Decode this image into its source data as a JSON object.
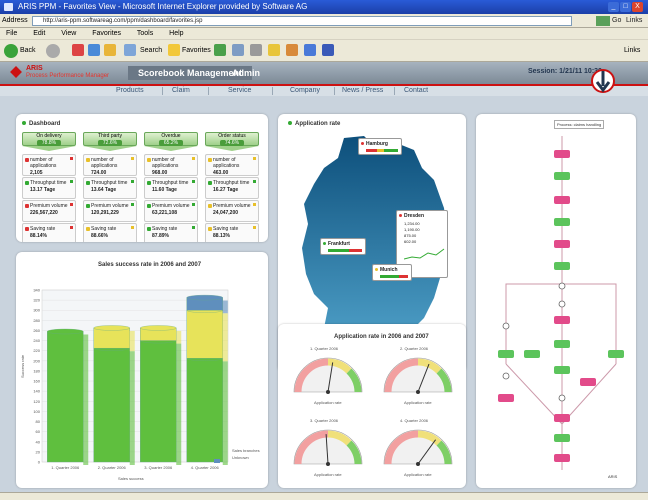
{
  "window": {
    "title": "ARIS PPM - Favorites View - Microsoft Internet Explorer provided by Software AG",
    "controls": [
      "_",
      "□",
      "X"
    ]
  },
  "address_bar": {
    "label": "Address",
    "url": "http://aris-ppm.softwareag.com/ppm/dashboard/favorites.jsp",
    "go_label": "Go",
    "links_label": "Links"
  },
  "menu": [
    "File",
    "Edit",
    "View",
    "Favorites",
    "Tools",
    "Help"
  ],
  "toolbar": {
    "back_label": "Back",
    "search_label": "Search",
    "favorites_label": "Favorites",
    "right_label": "Links"
  },
  "app": {
    "logo_title": "ARIS",
    "logo_subtitle": "Process Performance Manager",
    "tabs": [
      "Scorebook Management",
      "Admin"
    ],
    "session": "Session: 1/21/11 10:30",
    "nav": [
      "Products",
      "Claim",
      "Service",
      "Company",
      "News / Press",
      "Contact"
    ]
  },
  "kpi_panel": {
    "title": "Dashboard",
    "columns": [
      {
        "label": "On delivery",
        "pct": "78.8%"
      },
      {
        "label": "Third party",
        "pct": "72.6%"
      },
      {
        "label": "Overdue",
        "pct": "65.2%"
      },
      {
        "label": "Order status",
        "pct": "74.6%"
      }
    ],
    "rows": [
      {
        "cells": [
          {
            "label": "number of applications",
            "value": "2,105",
            "color": "#d33"
          },
          {
            "label": "number of applications",
            "value": "724.00",
            "color": "#e8c02a"
          },
          {
            "label": "number of applications",
            "value": "968.00",
            "color": "#e8c02a"
          },
          {
            "label": "number of applications",
            "value": "463.00",
            "color": "#e8c02a"
          }
        ]
      },
      {
        "cells": [
          {
            "label": "Throughput time",
            "value": "13.17 Tage",
            "color": "#3a3"
          },
          {
            "label": "Throughput time",
            "value": "13.64 Tage",
            "color": "#3a3"
          },
          {
            "label": "Throughput time",
            "value": "11.60 Tage",
            "color": "#3a3"
          },
          {
            "label": "Throughput time",
            "value": "16.27 Tage",
            "color": "#3a3"
          }
        ]
      },
      {
        "cells": [
          {
            "label": "Premium volume",
            "value": "226,567,220",
            "color": "#d33"
          },
          {
            "label": "Premium volume",
            "value": "120,291,229",
            "color": "#3a3"
          },
          {
            "label": "Premium volume",
            "value": "63,221,108",
            "color": "#3a3"
          },
          {
            "label": "Premium volume",
            "value": "24,047,200",
            "color": "#e8c02a"
          }
        ]
      },
      {
        "cells": [
          {
            "label": "Saving rate",
            "value": "88.14%",
            "color": "#d33"
          },
          {
            "label": "Saving rate",
            "value": "88.66%",
            "color": "#e8c02a"
          },
          {
            "label": "Saving rate",
            "value": "87.89%",
            "color": "#3a3"
          },
          {
            "label": "Saving rate",
            "value": "88.13%",
            "color": "#e8c02a"
          }
        ]
      }
    ]
  },
  "map_panel": {
    "title": "Application rate",
    "cities": [
      {
        "name": "Hamburg",
        "color": "#d33"
      },
      {
        "name": "Dresden",
        "color": "#d33"
      },
      {
        "name": "Frankfurt",
        "color": "#3a3"
      },
      {
        "name": "Munich",
        "color": "#e8c02a"
      }
    ],
    "dresden_rows": [
      "1,234.00",
      "1,190.00",
      "875.00",
      "602.00"
    ]
  },
  "bar_panel": {
    "title": "Sales success rate in 2006 and 2007",
    "ylabel": "Success rate",
    "xlabel": "Sales success",
    "legend": [
      "Sales branches",
      "Unknown"
    ]
  },
  "chart_data": {
    "type": "bar",
    "title": "Sales success rate in 2006 and 2007",
    "xlabel": "Sales success",
    "ylabel": "Success rate",
    "categories": [
      "1. Quarter 2006",
      "2. Quarter 2006",
      "3. Quarter 2006",
      "4. Quarter 2006"
    ],
    "ylim": [
      0,
      340
    ],
    "yticks": [
      0,
      20,
      40,
      60,
      80,
      100,
      120,
      140,
      160,
      180,
      200,
      220,
      240,
      260,
      280,
      300,
      320,
      340
    ],
    "series": [
      {
        "name": "2006",
        "values": [
          258,
          225,
          240,
          205
        ],
        "color": "#5fbf3e"
      },
      {
        "name": "2007",
        "values": [
          0,
          40,
          25,
          95
        ],
        "color": "#e7e35a"
      },
      {
        "name": "Unknown",
        "values": [
          0,
          0,
          0,
          25
        ],
        "color": "#5f8fbd"
      }
    ]
  },
  "gauge_panel": {
    "title": "Application rate in 2006 and 2007",
    "gauges": [
      {
        "label": "1. Quarter 2006",
        "value": 0.55
      },
      {
        "label": "2. Quarter 2006",
        "value": 0.62
      },
      {
        "label": "3. Quarter 2006",
        "value": 0.48
      },
      {
        "label": "4. Quarter 2006",
        "value": 0.7
      }
    ],
    "caption": "Application rate"
  },
  "process_panel": {
    "title": "Process instance",
    "legend_text": "Process: claims handling",
    "footer": "ARIS"
  }
}
